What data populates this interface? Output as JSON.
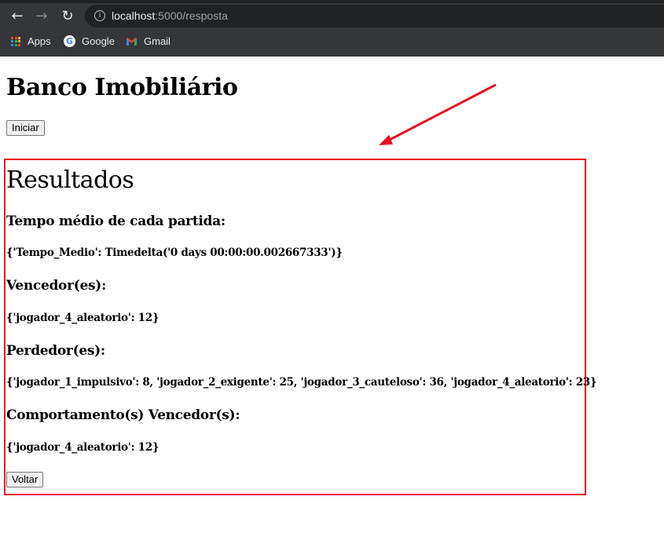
{
  "browser": {
    "url_host": "localhost",
    "url_path": ":5000/resposta",
    "bookmarks": [
      {
        "label": "Apps"
      },
      {
        "label": "Google"
      },
      {
        "label": "Gmail"
      }
    ],
    "icons": [
      "back-arrow-icon",
      "forward-arrow-icon",
      "reload-icon",
      "info-icon",
      "apps-grid-icon",
      "google-icon",
      "gmail-icon"
    ]
  },
  "page": {
    "title": "Banco Imobiliário",
    "start_button": "Iniciar",
    "results": {
      "title": "Resultados",
      "avg_time_label": "Tempo médio de cada partida:",
      "avg_time_value": "{'Tempo_Medio': Timedelta('0 days 00:00:00.002667333')}",
      "winners_label": "Vencedor(es):",
      "winners_value": "{'jogador_4_aleatorio': 12}",
      "losers_label": "Perdedor(es):",
      "losers_value": "{'jogador_1_impulsivo': 8, 'jogador_2_exigente': 25, 'jogador_3_cauteloso': 36, 'jogador_4_aleatorio': 23}",
      "winning_behaviour_label": "Comportamento(s) Vencedor(s):",
      "winning_behaviour_value": "{'jogador_4_aleatorio': 12}",
      "back_button": "Voltar"
    }
  },
  "annotation": {
    "color": "#e81123"
  }
}
